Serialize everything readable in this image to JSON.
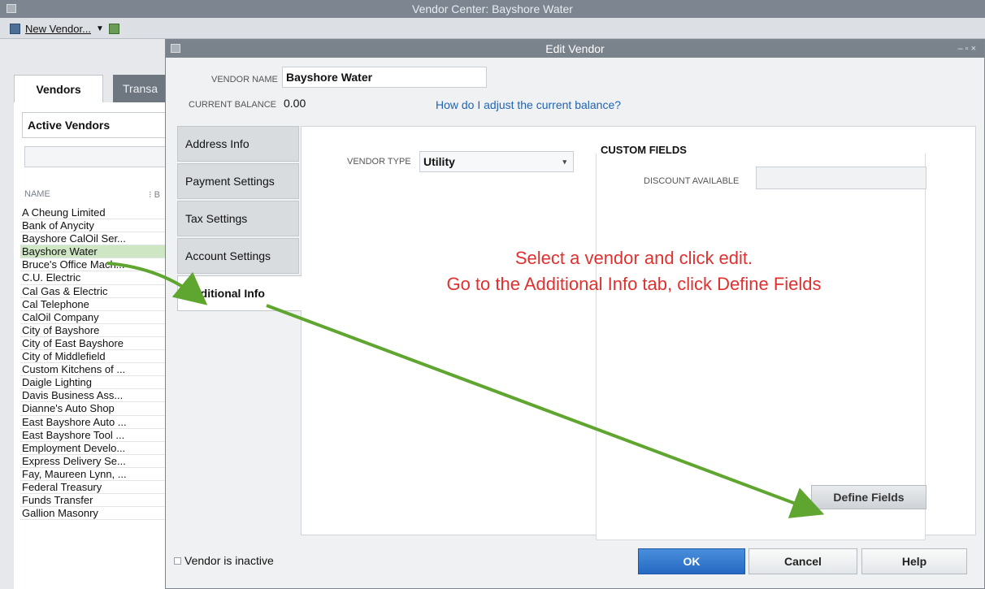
{
  "outer_window": {
    "title": "Vendor Center: Bayshore Water"
  },
  "toolbar": {
    "new_vendor_label": "New Vendor..."
  },
  "left_panel": {
    "tabs": [
      "Vendors",
      "Transa"
    ],
    "filter": "Active Vendors",
    "column_name": "NAME",
    "column_second": "B",
    "vendors": [
      "A Cheung Limited",
      "Bank of Anycity",
      "Bayshore CalOil Ser...",
      "Bayshore Water",
      "Bruce's Office Mach...",
      "C.U. Electric",
      "Cal Gas & Electric",
      "Cal Telephone",
      "CalOil Company",
      "City of Bayshore",
      "City of East Bayshore",
      "City of Middlefield",
      "Custom Kitchens of ...",
      "Daigle Lighting",
      "Davis Business Ass...",
      "Dianne's Auto Shop",
      "East Bayshore Auto ...",
      "East Bayshore Tool ...",
      "Employment Develo...",
      "Express Delivery Se...",
      "Fay, Maureen Lynn, ...",
      "Federal Treasury",
      "Funds Transfer",
      "Gallion Masonry"
    ],
    "selected_vendor": "Bayshore Water"
  },
  "dialog": {
    "title": "Edit Vendor",
    "vendor_name_label": "VENDOR NAME",
    "vendor_name": "Bayshore Water",
    "current_balance_label": "CURRENT BALANCE",
    "current_balance": "0.00",
    "adjust_link": "How do I adjust the current balance?",
    "tabs": [
      "Address Info",
      "Payment Settings",
      "Tax Settings",
      "Account Settings",
      "Additional Info"
    ],
    "active_tab": "Additional Info",
    "vendor_type_label": "VENDOR TYPE",
    "vendor_type": "Utility",
    "custom_fields_title": "CUSTOM FIELDS",
    "discount_label": "DISCOUNT AVAILABLE",
    "define_fields_label": "Define Fields",
    "inactive_label": "Vendor is inactive",
    "ok_label": "OK",
    "cancel_label": "Cancel",
    "help_label": "Help"
  },
  "annotation": {
    "line1": "Select a vendor and click edit.",
    "line2": "Go to the Additional Info tab, click Define Fields",
    "color": "#e03030",
    "arrow_color": "#5fa630"
  }
}
